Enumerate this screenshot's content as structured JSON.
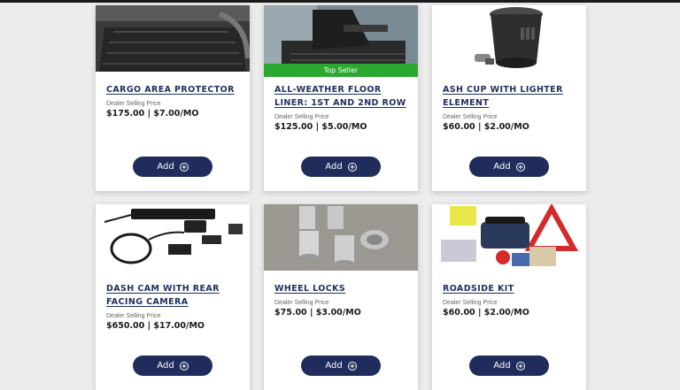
{
  "colors": {
    "navy": "#1e2f5e",
    "button": "#1f2c5c",
    "badge_green": "#2aa82f",
    "background": "#ececec"
  },
  "price_label": "Dealer Selling Price",
  "add_label": "Add",
  "products": [
    {
      "title": "CARGO AREA PROTECTOR",
      "price": "$175.00 | $7.00/MO",
      "badge": ""
    },
    {
      "title": "ALL-WEATHER FLOOR LINER: 1ST AND 2ND ROW",
      "price": "$125.00 | $5.00/MO",
      "badge": "Top Seller"
    },
    {
      "title": "ASH CUP WITH LIGHTER ELEMENT",
      "price": "$60.00 | $2.00/MO",
      "badge": ""
    },
    {
      "title": "DASH CAM WITH REAR FACING CAMERA",
      "price": "$650.00 | $17.00/MO",
      "badge": ""
    },
    {
      "title": "WHEEL LOCKS",
      "price": "$75.00 | $3.00/MO",
      "badge": ""
    },
    {
      "title": "ROADSIDE KIT",
      "price": "$60.00 | $2.00/MO",
      "badge": ""
    }
  ]
}
